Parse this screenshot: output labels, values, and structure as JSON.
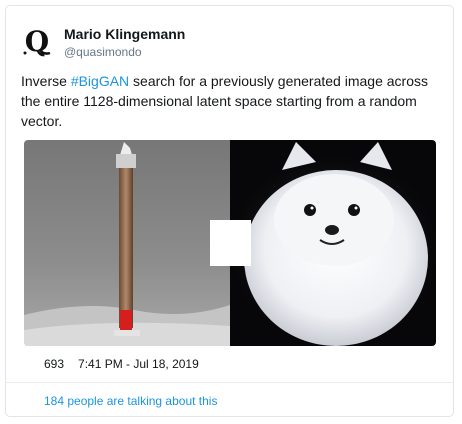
{
  "author": {
    "name": "Mario Klingemann",
    "handle": "@quasimondo",
    "avatar_icon": "avatar-q-logo"
  },
  "tweet": {
    "text_before": "Inverse ",
    "hashtag": "#BigGAN",
    "text_after": " search for a previously generated image across the entire 1128-dimensional latent space starting from a random vector."
  },
  "media": {
    "left_image": "chimney-pole-in-snow",
    "right_image": "white-fluffy-dog"
  },
  "meta": {
    "like_count": "693",
    "timestamp": "7:41 PM - Jul 18, 2019"
  },
  "conversation_link": "184 people are talking about this",
  "colors": {
    "link": "#1b95e0",
    "text": "#14171a",
    "muted": "#657786",
    "border": "#dfe5ea"
  }
}
